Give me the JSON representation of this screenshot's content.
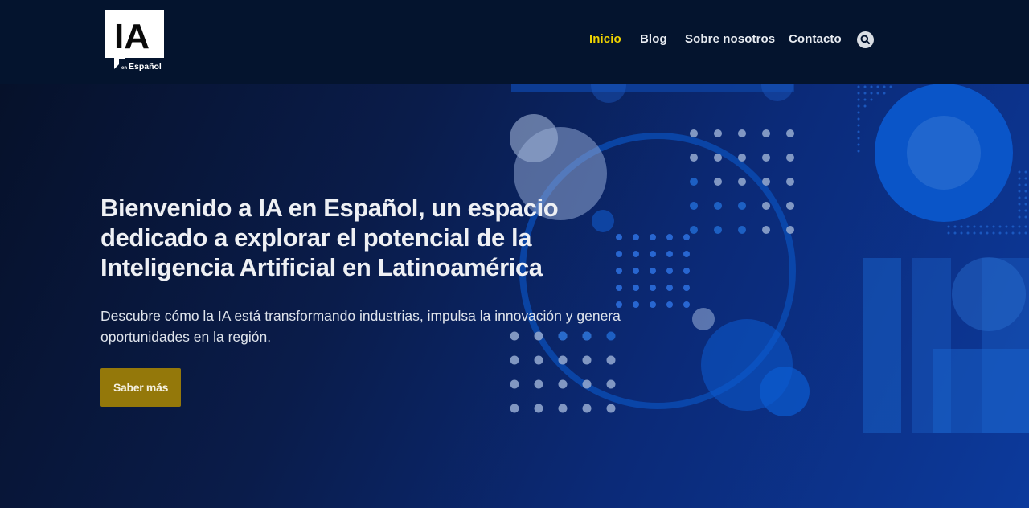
{
  "brand": {
    "logo_main": "IA",
    "logo_sub_small": "en",
    "logo_sub": "Español"
  },
  "nav": {
    "items": [
      {
        "label": "Inicio",
        "active": true
      },
      {
        "label": "Blog",
        "active": false
      },
      {
        "label": "Sobre nosotros",
        "active": false
      },
      {
        "label": "Contacto",
        "active": false
      }
    ],
    "search_icon": "search-icon"
  },
  "hero": {
    "title": "Bienvenido a IA en Español, un espacio dedicado a explorar el potencial de la Inteligencia Artificial en Latinoamérica",
    "subtitle": "Descubre cómo la IA está transformando industrias, impulsa la innovación y genera oportunidades en la región.",
    "cta_label": "Saber más"
  },
  "colors": {
    "header_bg": "#04142e",
    "active_nav": "#f0d400",
    "cta_bg": "#94780a",
    "accent_blue": "#0b5ccc"
  }
}
